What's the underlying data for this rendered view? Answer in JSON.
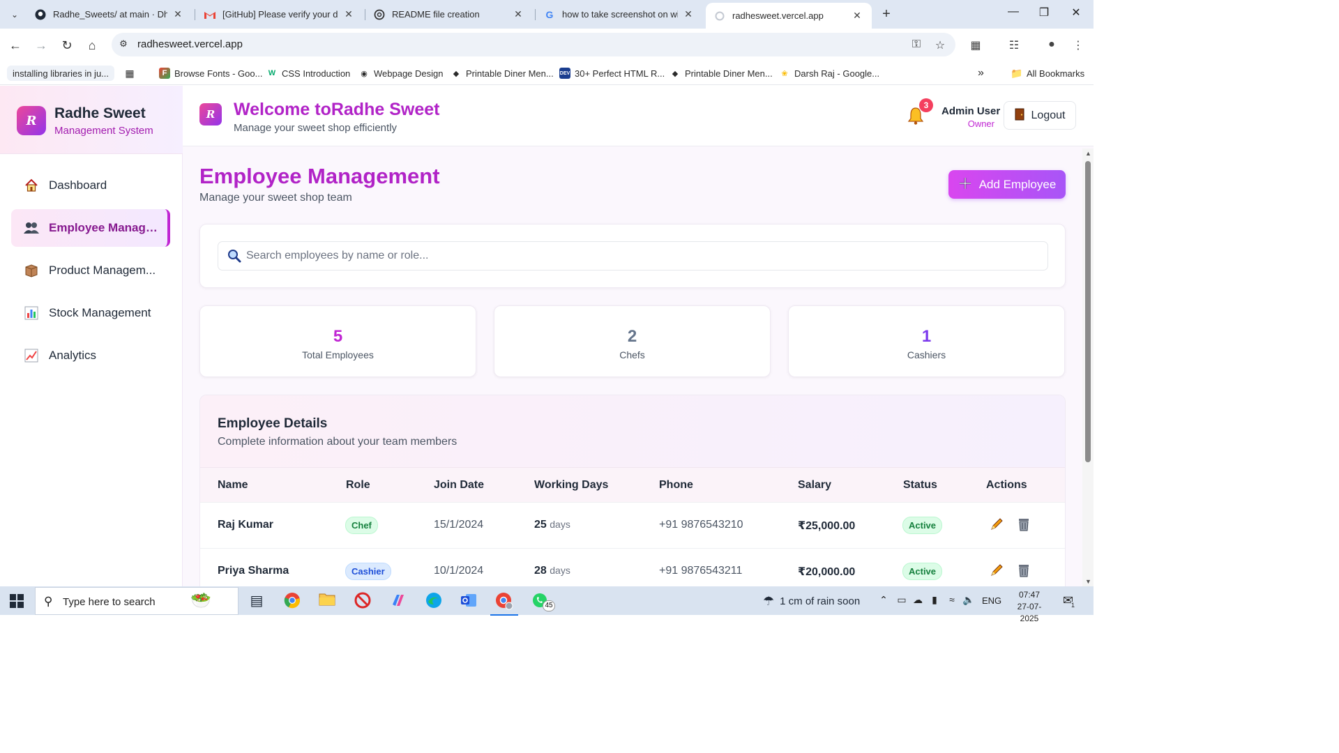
{
  "browser": {
    "tabs": [
      {
        "title": "Radhe_Sweets/ at main · Dhruv",
        "icon": "github-icon"
      },
      {
        "title": "[GitHub] Please verify your devi",
        "icon": "gmail-icon"
      },
      {
        "title": "README file creation",
        "icon": "openai-icon"
      },
      {
        "title": "how to take screenshot on winc",
        "icon": "google-icon"
      },
      {
        "title": "radhesweet.vercel.app",
        "icon": "loading-icon"
      }
    ],
    "url": "radhesweet.vercel.app",
    "bookmarks": [
      {
        "label": "installing libraries in ju..."
      },
      {
        "label": "Browse Fonts - Goo..."
      },
      {
        "label": "CSS Introduction"
      },
      {
        "label": "Webpage Design"
      },
      {
        "label": "Printable Diner Men..."
      },
      {
        "label": "30+ Perfect HTML R..."
      },
      {
        "label": "Printable Diner Men..."
      },
      {
        "label": "Darsh Raj - Google..."
      }
    ],
    "all_bookmarks": "All Bookmarks"
  },
  "sidebar": {
    "logo_letter": "R",
    "brand": "Radhe Sweet",
    "subtitle": "Management System",
    "items": [
      {
        "label": "Dashboard",
        "icon": "home-icon"
      },
      {
        "label": "Employee Manage...",
        "icon": "users-icon",
        "active": true
      },
      {
        "label": "Product Managem...",
        "icon": "box-icon"
      },
      {
        "label": "Stock Management",
        "icon": "bar-chart-icon"
      },
      {
        "label": "Analytics",
        "icon": "line-chart-icon"
      }
    ]
  },
  "header": {
    "logo_letter": "R",
    "title": "Welcome toRadhe Sweet",
    "subtitle": "Manage your sweet shop efficiently",
    "notification_count": "3",
    "user_name": "Admin User",
    "user_role": "Owner",
    "logout_label": "Logout"
  },
  "page": {
    "title": "Employee Management",
    "subtitle": "Manage your sweet shop team",
    "add_button": "Add Employee",
    "search_placeholder": "Search employees by name or role...",
    "stats": [
      {
        "value": "5",
        "label": "Total Employees",
        "color": "#c026d3"
      },
      {
        "value": "2",
        "label": "Chefs",
        "color": "#64748b"
      },
      {
        "value": "1",
        "label": "Cashiers",
        "color": "#7c3aed"
      }
    ],
    "table": {
      "title": "Employee Details",
      "subtitle": "Complete information about your team members",
      "columns": [
        "Name",
        "Role",
        "Join Date",
        "Working Days",
        "Phone",
        "Salary",
        "Status",
        "Actions"
      ],
      "rows": [
        {
          "name": "Raj Kumar",
          "role": "Chef",
          "join_date": "15/1/2024",
          "working_days": "25",
          "days_unit": "days",
          "phone": "+91 9876543210",
          "salary": "₹25,000.00",
          "status": "Active"
        },
        {
          "name": "Priya Sharma",
          "role": "Cashier",
          "join_date": "10/1/2024",
          "working_days": "28",
          "days_unit": "days",
          "phone": "+91 9876543211",
          "salary": "₹20,000.00",
          "status": "Active"
        }
      ]
    }
  },
  "taskbar": {
    "search_placeholder": "Type here to search",
    "whatsapp_badge": "45",
    "weather": "1 cm of rain soon",
    "language": "ENG",
    "time": "07:47",
    "date": "27-07-2025",
    "notification_count": "1"
  }
}
